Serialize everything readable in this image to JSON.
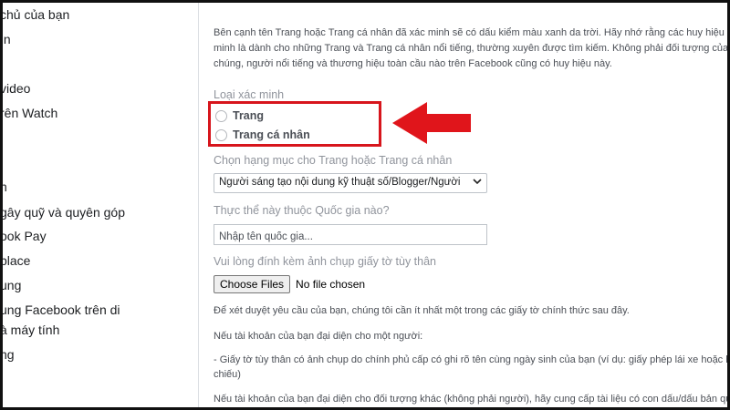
{
  "sidebar": {
    "items": [
      {
        "label": "chủ của bạn"
      },
      {
        "label": "ın"
      },
      {
        "label": " video"
      },
      {
        "label": "rên Watch"
      },
      {
        "label": "n"
      },
      {
        "label": "gây quỹ và quyên góp"
      },
      {
        "label": "ook Pay"
      },
      {
        "label": "place"
      },
      {
        "label": "ung"
      },
      {
        "label": "ung Facebook trên di"
      },
      {
        "label": "à máy tính"
      },
      {
        "label": "ng"
      }
    ]
  },
  "main": {
    "intro_lines": [
      "Bên cạnh tên Trang hoặc Trang cá nhân đã xác minh sẽ có dấu kiểm màu xanh da trời. Hãy nhớ rằng các huy hiệu",
      "minh là dành cho những Trang và Trang cá nhân nổi tiếng, thường xuyên được tìm kiếm. Không phải đối tượng của",
      "chúng, người nổi tiếng và thương hiệu toàn cầu nào trên Facebook cũng có huy hiệu này."
    ],
    "verification_type_label": "Loại xác minh",
    "radio_options": [
      {
        "label": "Trang"
      },
      {
        "label": "Trang cá nhân"
      }
    ],
    "category_label": "Chọn hạng mục cho Trang hoặc Trang cá nhân",
    "category_value": "Người sáng tạo nội dung kỹ thuật số/Blogger/Người",
    "country_label": "Thực thể này thuộc Quốc gia nào?",
    "country_placeholder": "Nhập tên quốc gia...",
    "id_label": "Vui lòng đính kèm ảnh chụp giấy tờ tùy thân",
    "file_button_label": "Choose Files",
    "file_status": "No file chosen",
    "paragraphs": [
      "Để xét duyệt yêu cầu của bạn, chúng tôi cần ít nhất một trong các giấy tờ chính thức sau đây.",
      "Nếu tài khoản của bạn đại diện cho một người:",
      "- Giấy tờ tùy thân có ảnh chụp do chính phủ cấp có ghi rõ tên cùng ngày sinh của bạn (ví dụ: giấy phép lái xe hoặc h",
      "chiếu)",
      "Nếu tài khoản của bạn đại diện cho đối tượng khác (không phải người), hãy cung cấp tài liệu có con dấu/dấu bản qu"
    ]
  },
  "annotation": {
    "highlight_color": "#d7151c",
    "arrow_icon": "arrow-left-icon"
  }
}
